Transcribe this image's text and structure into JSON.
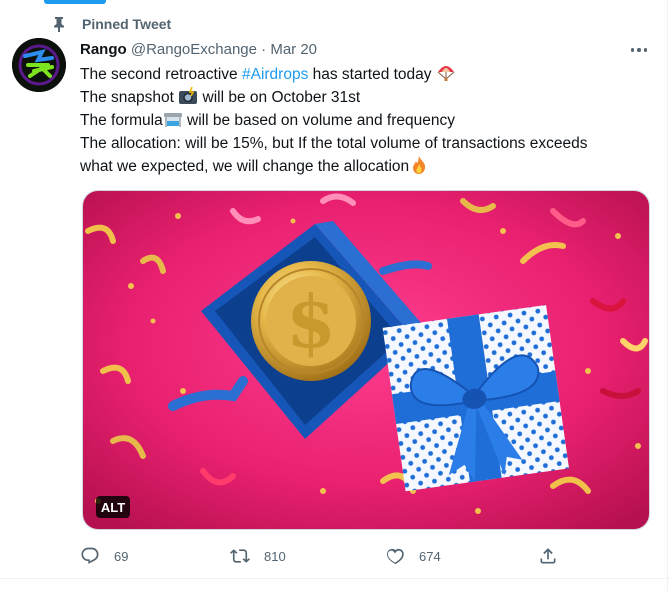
{
  "pinned": {
    "label": "Pinned Tweet",
    "icon": "pin-icon"
  },
  "tweet": {
    "author_name": "Rango",
    "handle": "@RangoExchange",
    "separator": "·",
    "date": "Mar 20",
    "more_icon": "more-icon",
    "lines": [
      {
        "before": "The second retroactive ",
        "hashtag": "#Airdrops",
        "after": " has started today",
        "emoji": "parachute"
      },
      {
        "before": "The snapshot ",
        "emoji": "camera-flash",
        "after": " will be on October 31st"
      },
      {
        "before": "The formula",
        "emoji": "test-tube",
        "after": " will be based on volume and frequency"
      },
      {
        "text": "The allocation: will be 15%, but If the total volume of transactions exceeds"
      },
      {
        "before": "what we expected, we will change the allocation",
        "emoji": "fire"
      }
    ],
    "media": {
      "alt_label": "ALT",
      "description_icon": "gift-box-coin-image"
    },
    "actions": {
      "replies": "69",
      "retweets": "810",
      "likes": "674"
    }
  },
  "colors": {
    "accent": "#1d9bf0",
    "text": "#0f1419",
    "muted": "#536471",
    "media_bg": "#e8206f"
  }
}
